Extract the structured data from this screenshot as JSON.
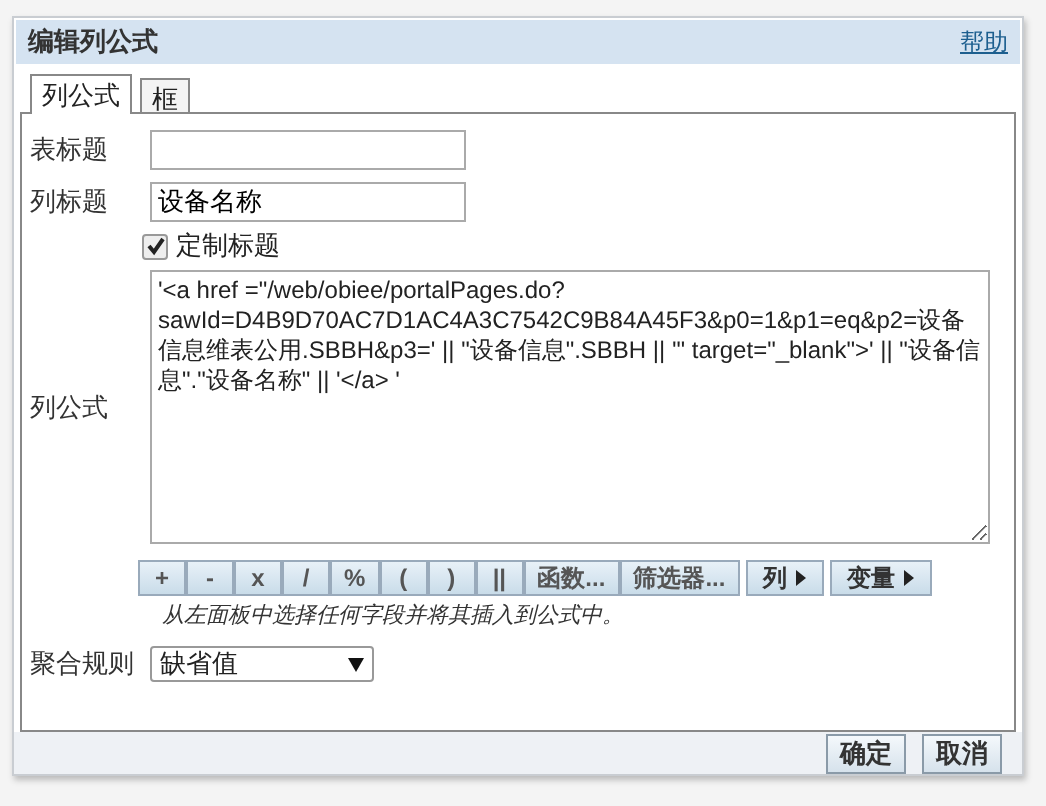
{
  "window": {
    "title": "编辑列公式",
    "help_link": "帮助"
  },
  "tabs": [
    {
      "label": "列公式",
      "selected": true
    },
    {
      "label": "框",
      "selected": false
    }
  ],
  "form": {
    "table_heading": {
      "label": "表标题"
    },
    "column_heading": {
      "label": "列标题",
      "value": "设备名称"
    },
    "custom_heading": {
      "label": "定制标题",
      "checked": true
    },
    "formula": {
      "label": "列公式",
      "value": "'<a href =\"/web/obiee/portalPages.do?sawId=D4B9D70AC7D1AC4A3C7542C9B84A45F3&p0=1&p1=eq&p2=设备信息维表公用.SBBH&p3=' || \"设备信息\".SBBH || '\" target=\"_blank\">' || \"设备信息\".\"设备名称\" || '</a> '"
    },
    "formula_buttons": [
      {
        "label": "+",
        "kind": "plain"
      },
      {
        "label": "-",
        "kind": "plain"
      },
      {
        "label": "x",
        "kind": "plain"
      },
      {
        "label": "/",
        "kind": "plain"
      },
      {
        "label": "%",
        "kind": "plain"
      },
      {
        "label": "(",
        "kind": "plain"
      },
      {
        "label": ")",
        "kind": "plain"
      },
      {
        "label": "||",
        "kind": "plain"
      },
      {
        "label": "函数...",
        "kind": "plain"
      },
      {
        "label": "筛选器...",
        "kind": "plain"
      },
      {
        "label": "列",
        "kind": "menu"
      },
      {
        "label": "变量",
        "kind": "menu"
      }
    ],
    "hint": "从左面板中选择任何字段并将其插入到公式中。",
    "aggregation": {
      "label": "聚合规则",
      "value": "缺省值"
    }
  },
  "buttons": [
    "确定",
    "取消"
  ]
}
